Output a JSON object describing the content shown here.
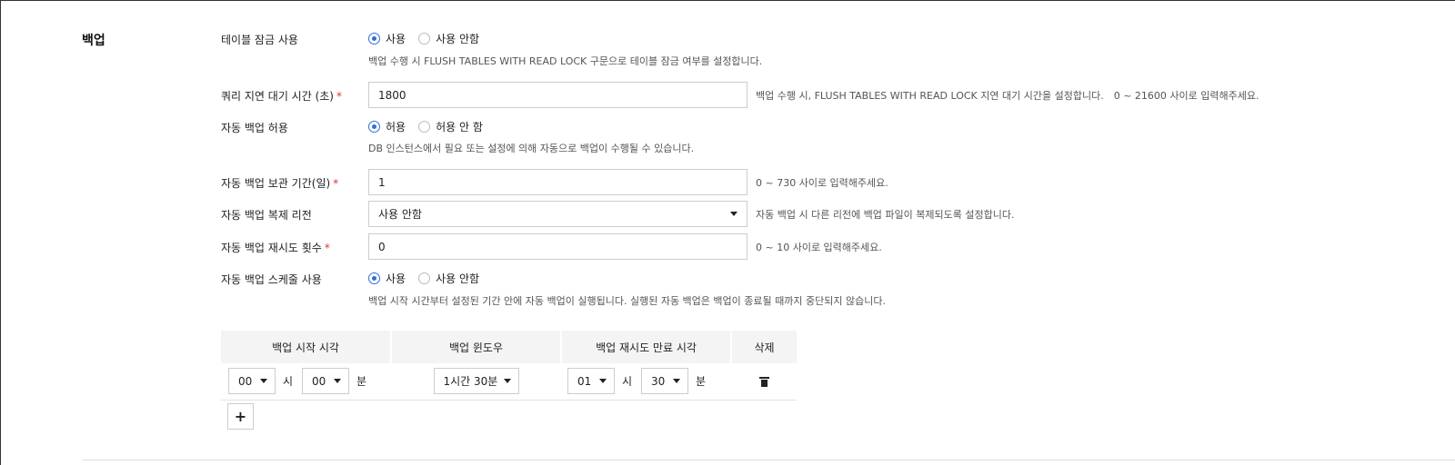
{
  "section": {
    "title": "백업"
  },
  "table_lock": {
    "label": "테이블 잠금 사용",
    "options": [
      "사용",
      "사용 안함"
    ],
    "selected": 0,
    "help": "백업 수행 시 FLUSH TABLES WITH READ LOCK 구문으로 테이블 잠금 여부를 설정합니다."
  },
  "query_delay": {
    "label": "쿼리 지연 대기 시간 (초)",
    "required": "*",
    "value": "1800",
    "help": "백업 수행 시, FLUSH TABLES WITH READ LOCK 지연 대기 시간을 설정합니다.",
    "range": "0 ~ 21600 사이로 입력해주세요."
  },
  "auto_backup": {
    "label": "자동 백업 허용",
    "options": [
      "허용",
      "허용 안 함"
    ],
    "selected": 0,
    "help": "DB 인스턴스에서 필요 또는 설정에 의해 자동으로 백업이 수행될 수 있습니다."
  },
  "retention": {
    "label": "자동 백업 보관 기간(일)",
    "required": "*",
    "value": "1",
    "range": "0 ~ 730 사이로 입력해주세요."
  },
  "replication_region": {
    "label": "자동 백업 복제 리전",
    "value": "사용 안함",
    "help": "자동 백업 시 다른 리전에 백업 파일이 복제되도록 설정합니다."
  },
  "retry_count": {
    "label": "자동 백업 재시도 횟수",
    "required": "*",
    "value": "0",
    "range": "0 ~ 10 사이로 입력해주세요."
  },
  "schedule": {
    "label": "자동 백업 스케줄 사용",
    "options": [
      "사용",
      "사용 안함"
    ],
    "selected": 0,
    "help": "백업 시작 시간부터 설정된 기간 안에 자동 백업이 실행됩니다. 실행된 자동 백업은 백업이 종료될 때까지 중단되지 않습니다.",
    "columns": [
      "백업 시작 시각",
      "백업 윈도우",
      "백업 재시도 만료 시각",
      "삭제"
    ],
    "rows": [
      {
        "start_hour": "00",
        "start_min": "00",
        "window": "1시간 30분",
        "expire_hour": "01",
        "expire_min": "30"
      }
    ],
    "hour_unit": "시",
    "min_unit": "분",
    "add_label": "+"
  },
  "colors": {
    "accent": "#2f6fd6",
    "required": "#e03030"
  }
}
